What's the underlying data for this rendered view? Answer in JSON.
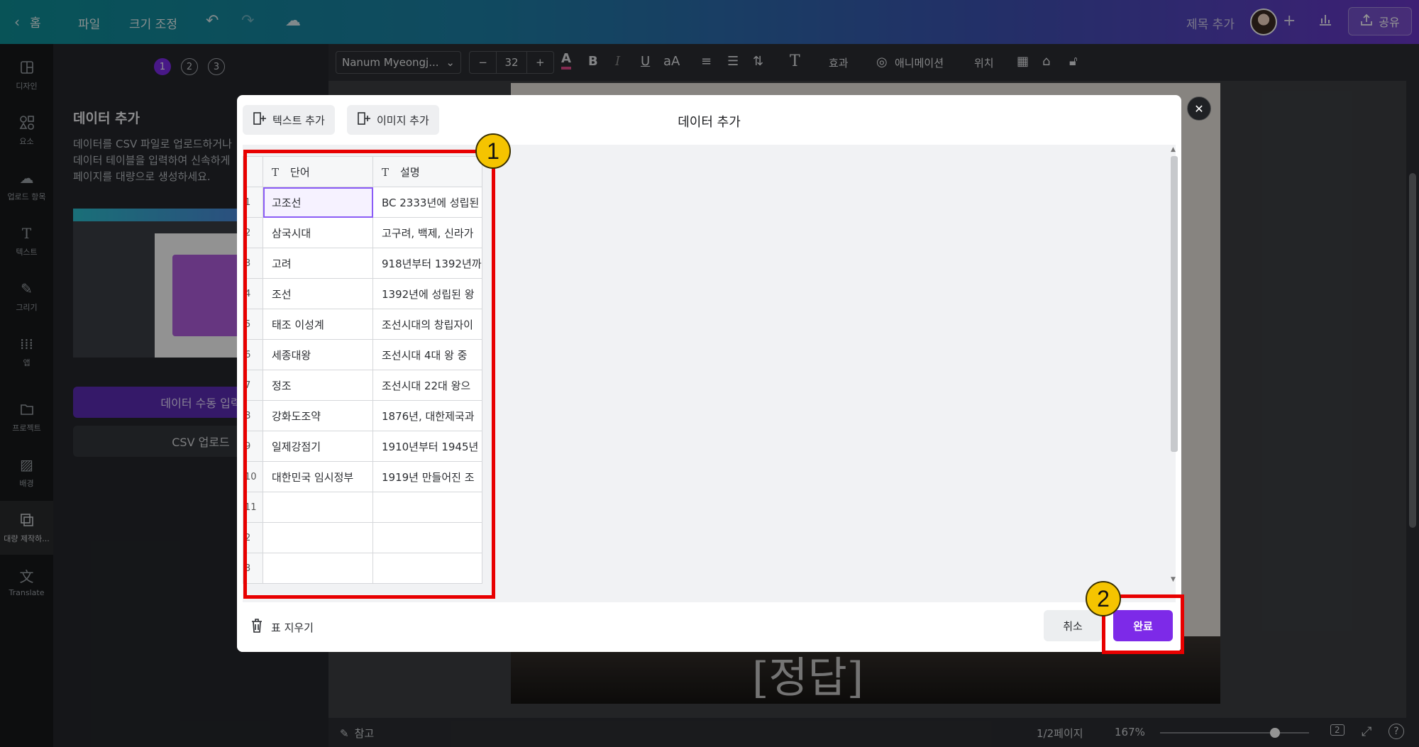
{
  "topbar": {
    "home": "홈",
    "file": "파일",
    "resize": "크기 조정",
    "add_title": "제목 추가",
    "share": "공유"
  },
  "rail": [
    {
      "label": "디자인",
      "icon": "layout-icon"
    },
    {
      "label": "요소",
      "icon": "shapes-icon"
    },
    {
      "label": "업로드 항목",
      "icon": "upload-icon"
    },
    {
      "label": "텍스트",
      "icon": "text-icon"
    },
    {
      "label": "그리기",
      "icon": "draw-icon"
    },
    {
      "label": "앱",
      "icon": "apps-icon"
    },
    {
      "label": "프로젝트",
      "icon": "folder-icon"
    },
    {
      "label": "배경",
      "icon": "background-icon"
    },
    {
      "label": "대량 제작하...",
      "icon": "bulk-create-icon"
    },
    {
      "label": "Translate",
      "icon": "translate-icon"
    }
  ],
  "sidepanel": {
    "steps": [
      "1",
      "2",
      "3"
    ],
    "title": "데이터 추가",
    "desc_lines": [
      "데이터를 CSV 파일로 업로드하거나",
      "데이터 테이블을 입력하여 신속하게",
      "페이지를 대량으로 생성하세요."
    ],
    "manual_entry": "데이터 수동 입력",
    "csv_upload": "CSV 업로드"
  },
  "toolbar": {
    "font": "Nanum Myeongj...",
    "font_size": "32",
    "minus": "−",
    "plus": "+",
    "bold": "B",
    "italic": "I",
    "underline": "U",
    "case": "aA",
    "effects": "효과",
    "animate": "애니메이션",
    "position": "위치"
  },
  "canvas": {
    "answer_text": "[정답]"
  },
  "bottombar": {
    "notes": "참고",
    "page": "1/2페이지",
    "zoom": "167%",
    "page_count": "2"
  },
  "modal": {
    "add_text": "텍스트 추가",
    "add_image": "이미지 추가",
    "title": "데이터 추가",
    "clear_table": "표 지우기",
    "cancel": "취소",
    "done": "완료",
    "columns": [
      "단어",
      "설명"
    ],
    "rows": [
      {
        "n": "1",
        "word": "고조선",
        "desc": "BC 2333년에 성립된"
      },
      {
        "n": "2",
        "word": "삼국시대",
        "desc": "고구려, 백제, 신라가"
      },
      {
        "n": "3",
        "word": "고려",
        "desc": "918년부터 1392년까"
      },
      {
        "n": "4",
        "word": "조선",
        "desc": "1392년에 성립된 왕"
      },
      {
        "n": "5",
        "word": "태조 이성계",
        "desc": "조선시대의 창립자이"
      },
      {
        "n": "6",
        "word": "세종대왕",
        "desc": "조선시대 4대 왕 중 "
      },
      {
        "n": "7",
        "word": "정조",
        "desc": "조선시대 22대 왕으"
      },
      {
        "n": "8",
        "word": "강화도조약",
        "desc": "1876년, 대한제국과"
      },
      {
        "n": "9",
        "word": "일제강점기",
        "desc": "1910년부터 1945년"
      },
      {
        "n": "10",
        "word": "대한민국 임시정부",
        "desc": "1919년 만들어진 조"
      },
      {
        "n": "11",
        "word": "",
        "desc": ""
      },
      {
        "n": "2",
        "word": "",
        "desc": ""
      },
      {
        "n": "3",
        "word": "",
        "desc": ""
      }
    ]
  },
  "annotations": {
    "badge1": "1",
    "badge2": "2"
  },
  "colors": {
    "accent": "#7d2ae8",
    "annotation_red": "#e80000",
    "badge_yellow": "#f5c400"
  }
}
